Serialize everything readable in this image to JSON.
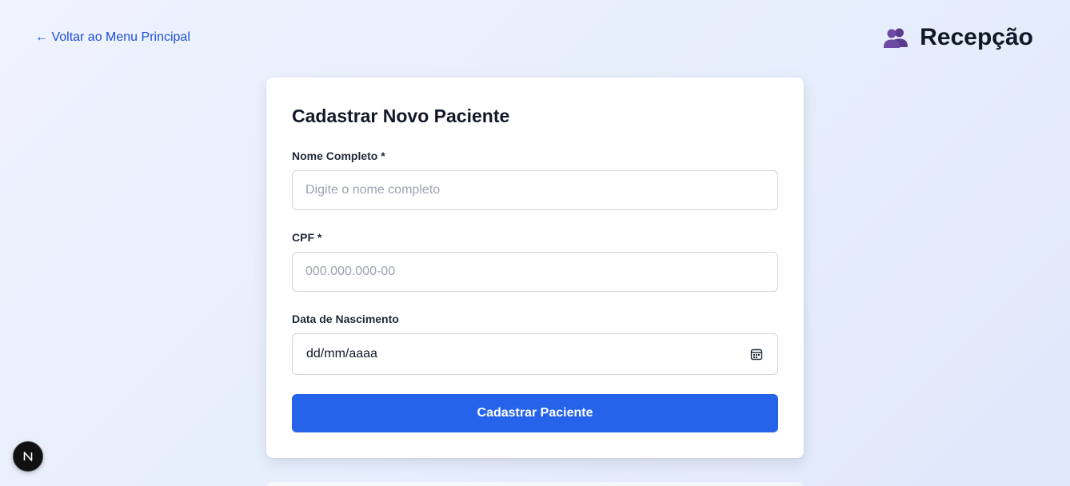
{
  "nav": {
    "back_label": "← Voltar ao Menu Principal"
  },
  "header": {
    "icon": "users-icon",
    "title": "Recepção"
  },
  "form": {
    "title": "Cadastrar Novo Paciente",
    "name_label": "Nome Completo *",
    "name_placeholder": "Digite o nome completo",
    "name_value": "",
    "cpf_label": "CPF *",
    "cpf_placeholder": "000.000.000-00",
    "cpf_value": "",
    "birth_label": "Data de Nascimento",
    "birth_placeholder": "dd/mm/aaaa",
    "birth_icon": "calendar-icon",
    "submit_label": "Cadastrar Paciente"
  },
  "badge": {
    "icon": "nextjs-icon",
    "letter": "N"
  },
  "colors": {
    "accent": "#2563eb",
    "link": "#1d4ed8",
    "icon_purple": "#5b3b8c",
    "text_dark": "#111827"
  }
}
